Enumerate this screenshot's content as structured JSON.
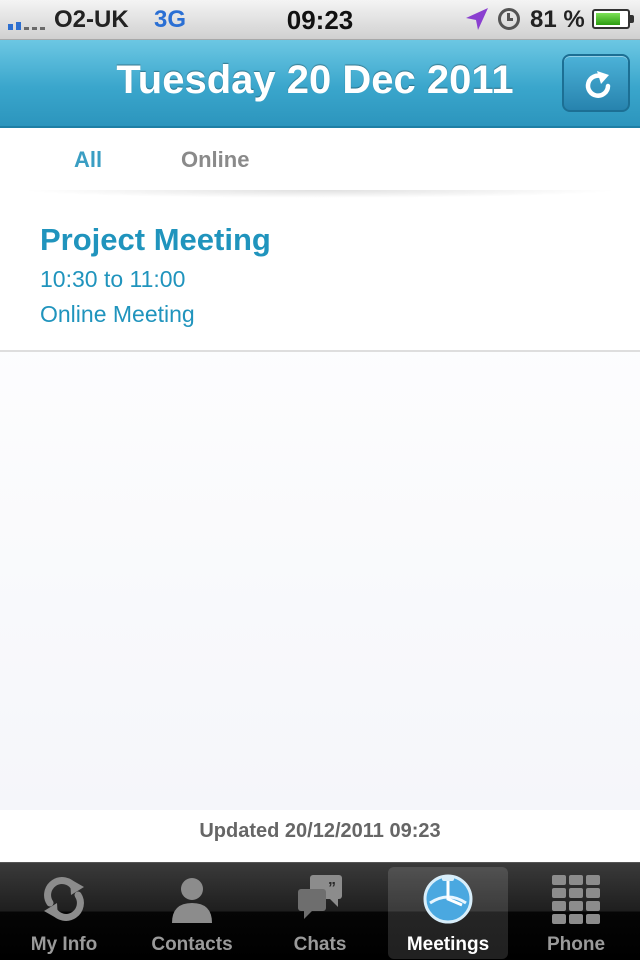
{
  "status_bar": {
    "carrier": "O2-UK",
    "network": "3G",
    "time": "09:23",
    "battery": "81 %",
    "battery_level": 0.81
  },
  "header": {
    "title": "Tuesday 20 Dec 2011",
    "refresh_icon": "refresh-icon"
  },
  "filter": {
    "tabs": [
      "All",
      "Online"
    ],
    "selected": "All"
  },
  "meetings": [
    {
      "title": "Project Meeting",
      "time": "10:30 to 11:00",
      "type": "Online Meeting"
    }
  ],
  "footer": {
    "updated": "Updated 20/12/2011 09:23"
  },
  "tab_bar": {
    "items": [
      {
        "label": "My Info",
        "icon": "sync-icon"
      },
      {
        "label": "Contacts",
        "icon": "person-icon"
      },
      {
        "label": "Chats",
        "icon": "chat-bubbles-icon"
      },
      {
        "label": "Meetings",
        "icon": "meetings-globe-icon"
      },
      {
        "label": "Phone",
        "icon": "keypad-icon"
      }
    ],
    "selected": "Meetings"
  },
  "colors": {
    "accent": "#2094bd",
    "header_blue": "#3aa6cc"
  }
}
